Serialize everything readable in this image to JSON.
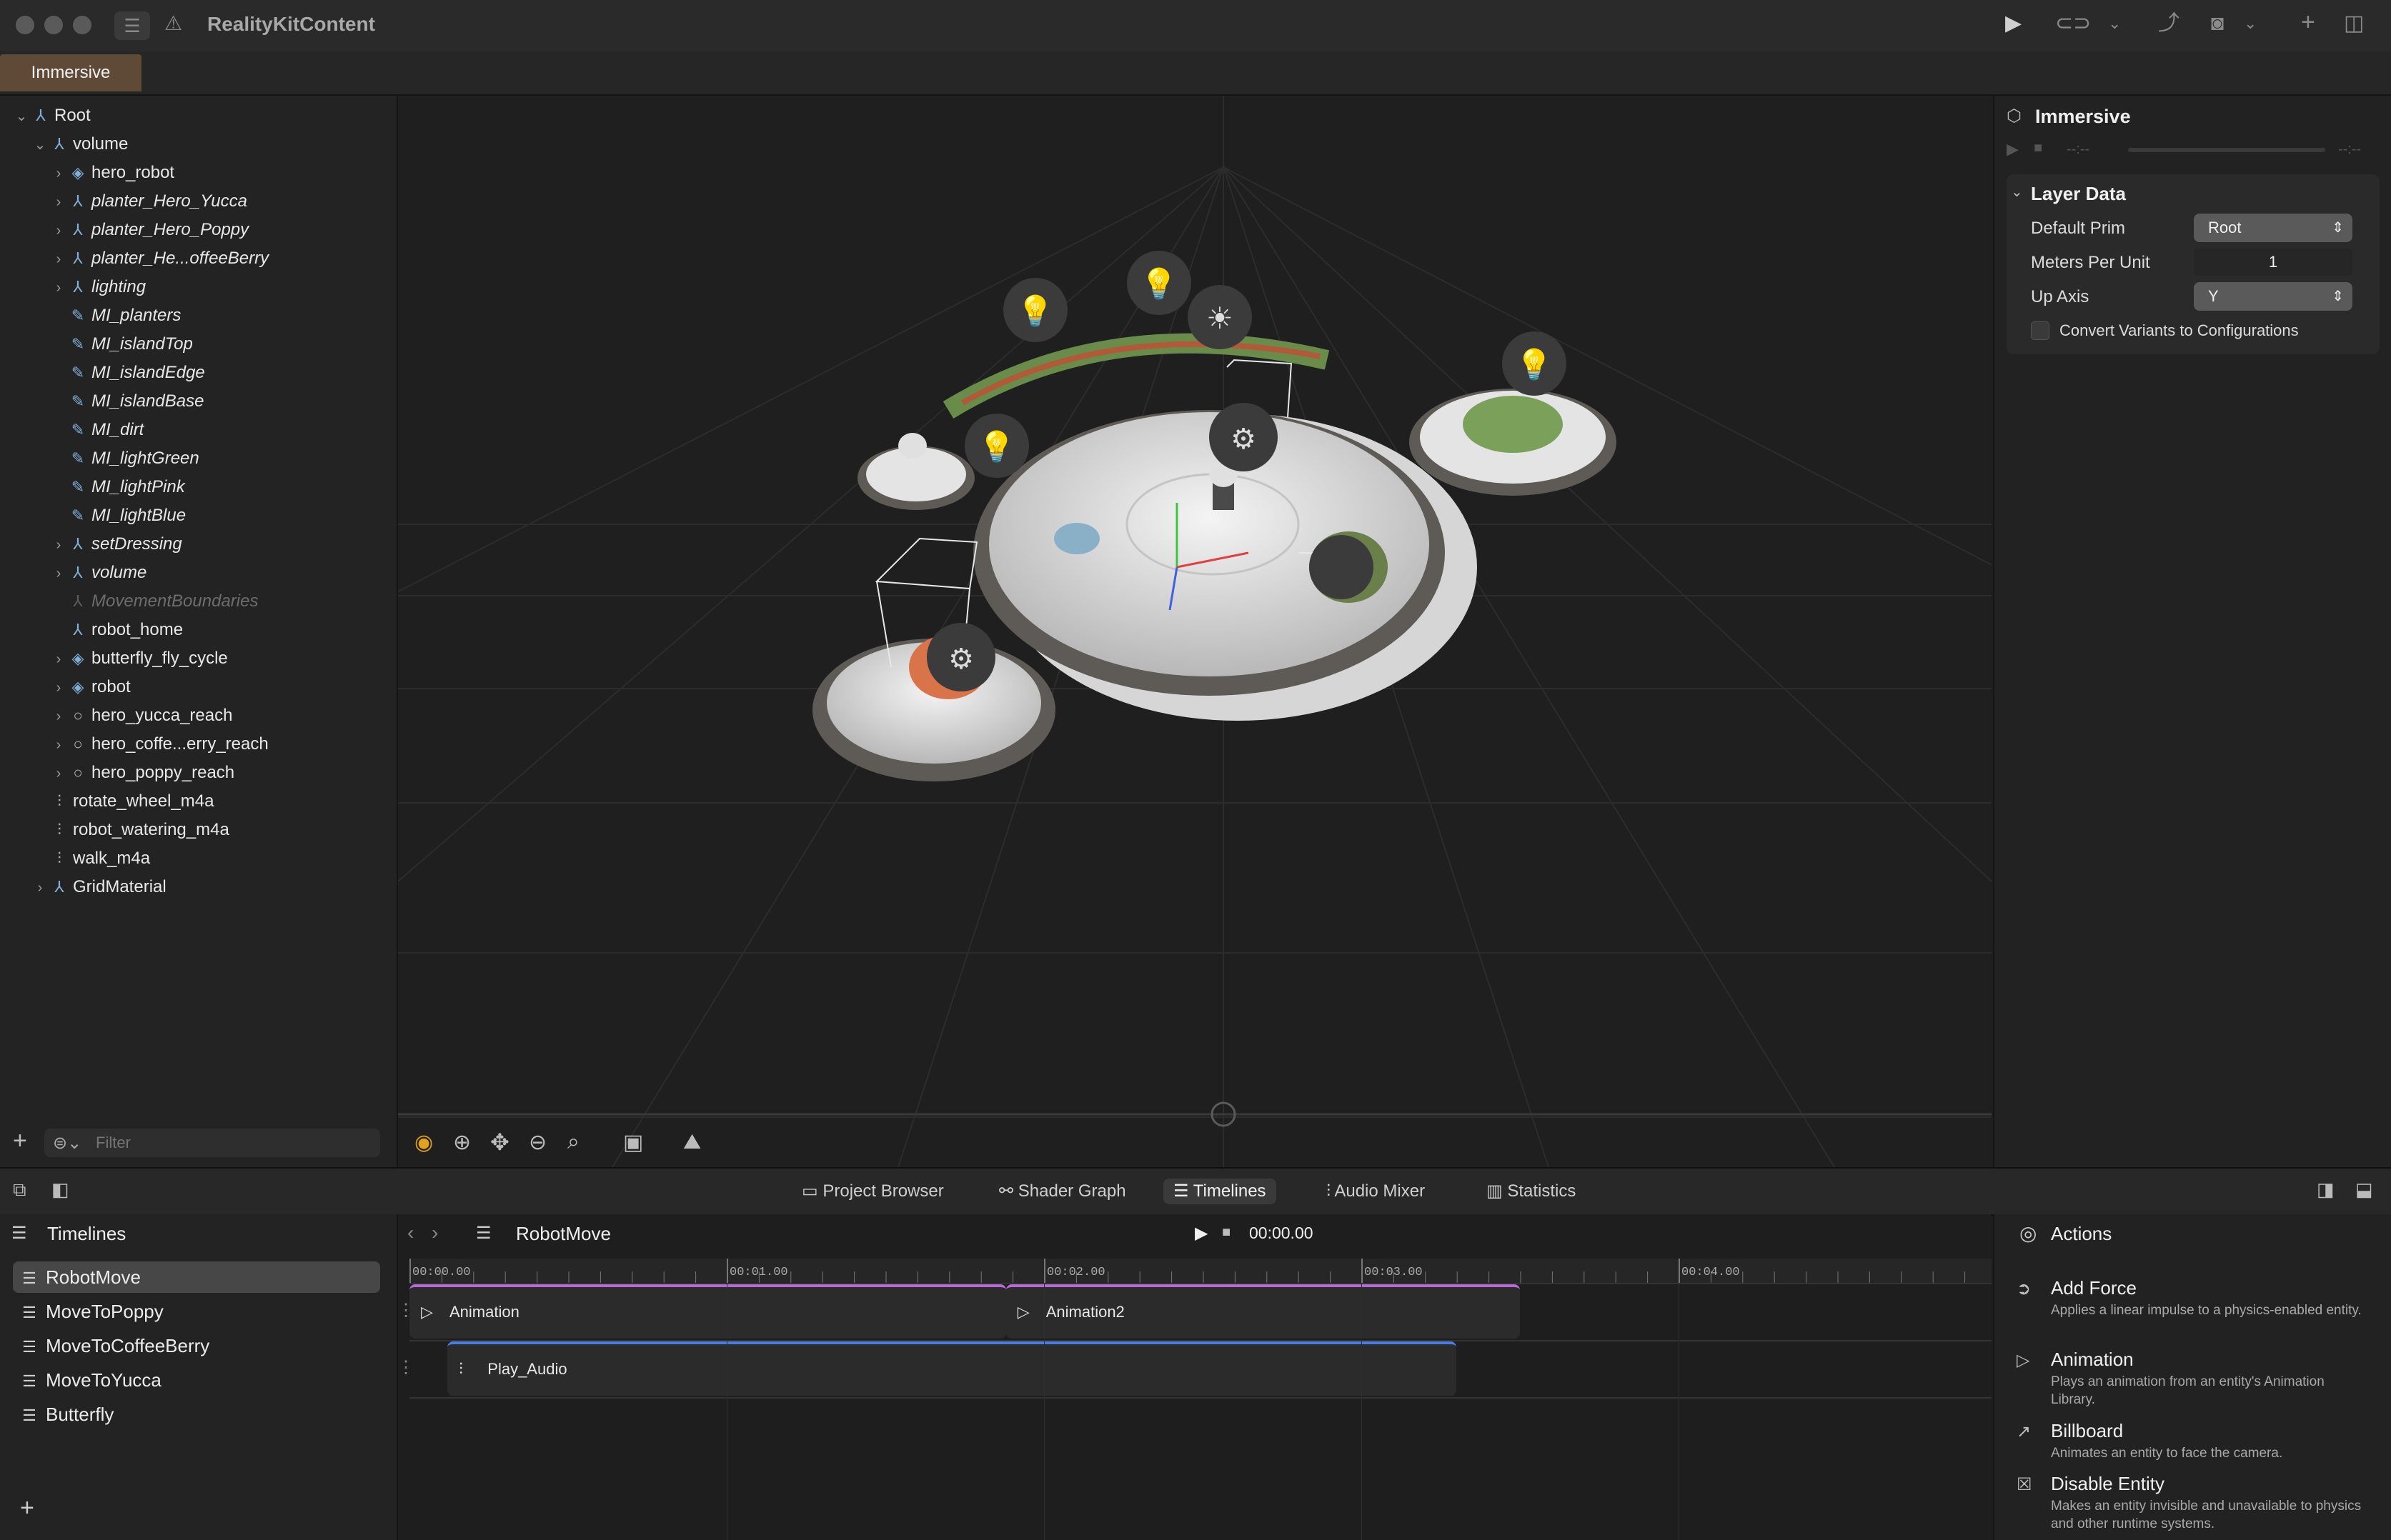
{
  "app": {
    "title": "RealityKitContent"
  },
  "tabs": {
    "immersive": "Immersive"
  },
  "hierarchy": [
    {
      "label": "Root",
      "depth": 0,
      "chevron": "open",
      "icon": "⅄",
      "style": ""
    },
    {
      "label": "volume",
      "depth": 1,
      "chevron": "open",
      "icon": "⅄",
      "style": ""
    },
    {
      "label": "hero_robot",
      "depth": 2,
      "chevron": "closed",
      "icon": "◈",
      "style": ""
    },
    {
      "label": "planter_Hero_Yucca",
      "depth": 2,
      "chevron": "closed",
      "icon": "⅄",
      "style": "italic"
    },
    {
      "label": "planter_Hero_Poppy",
      "depth": 2,
      "chevron": "closed",
      "icon": "⅄",
      "style": "italic"
    },
    {
      "label": "planter_He...offeeBerry",
      "depth": 2,
      "chevron": "closed",
      "icon": "⅄",
      "style": "italic"
    },
    {
      "label": "lighting",
      "depth": 2,
      "chevron": "closed",
      "icon": "⅄",
      "style": "italic"
    },
    {
      "label": "MI_planters",
      "depth": 2,
      "chevron": "",
      "icon": "✎",
      "style": "italic"
    },
    {
      "label": "MI_islandTop",
      "depth": 2,
      "chevron": "",
      "icon": "✎",
      "style": "italic"
    },
    {
      "label": "MI_islandEdge",
      "depth": 2,
      "chevron": "",
      "icon": "✎",
      "style": "italic"
    },
    {
      "label": "MI_islandBase",
      "depth": 2,
      "chevron": "",
      "icon": "✎",
      "style": "italic"
    },
    {
      "label": "MI_dirt",
      "depth": 2,
      "chevron": "",
      "icon": "✎",
      "style": "italic"
    },
    {
      "label": "MI_lightGreen",
      "depth": 2,
      "chevron": "",
      "icon": "✎",
      "style": "italic"
    },
    {
      "label": "MI_lightPink",
      "depth": 2,
      "chevron": "",
      "icon": "✎",
      "style": "italic"
    },
    {
      "label": "MI_lightBlue",
      "depth": 2,
      "chevron": "",
      "icon": "✎",
      "style": "italic"
    },
    {
      "label": "setDressing",
      "depth": 2,
      "chevron": "closed",
      "icon": "⅄",
      "style": "italic"
    },
    {
      "label": "volume",
      "depth": 2,
      "chevron": "closed",
      "icon": "⅄",
      "style": "italic"
    },
    {
      "label": "MovementBoundaries",
      "depth": 2,
      "chevron": "",
      "icon": "⅄",
      "style": "italic dim"
    },
    {
      "label": "robot_home",
      "depth": 2,
      "chevron": "",
      "icon": "⅄",
      "style": ""
    },
    {
      "label": "butterfly_fly_cycle",
      "depth": 2,
      "chevron": "closed",
      "icon": "◈",
      "style": ""
    },
    {
      "label": "robot",
      "depth": 2,
      "chevron": "closed",
      "icon": "◈",
      "style": ""
    },
    {
      "label": "hero_yucca_reach",
      "depth": 2,
      "chevron": "closed",
      "icon": "○",
      "style": "circle"
    },
    {
      "label": "hero_coffe...erry_reach",
      "depth": 2,
      "chevron": "closed",
      "icon": "○",
      "style": "circle"
    },
    {
      "label": "hero_poppy_reach",
      "depth": 2,
      "chevron": "closed",
      "icon": "○",
      "style": "circle"
    },
    {
      "label": "rotate_wheel_m4a",
      "depth": 1,
      "chevron": "",
      "icon": "⫶",
      "style": "audio"
    },
    {
      "label": "robot_watering_m4a",
      "depth": 1,
      "chevron": "",
      "icon": "⫶",
      "style": "audio"
    },
    {
      "label": "walk_m4a",
      "depth": 1,
      "chevron": "",
      "icon": "⫶",
      "style": "audio"
    },
    {
      "label": "GridMaterial",
      "depth": 1,
      "chevron": "closed",
      "icon": "⅄",
      "style": ""
    }
  ],
  "filter": {
    "placeholder": "Filter"
  },
  "inspector": {
    "title": "Immersive",
    "section": "Layer Data",
    "default_prim_label": "Default Prim",
    "default_prim_value": "Root",
    "meters_per_unit_label": "Meters Per Unit",
    "meters_per_unit_value": "1",
    "up_axis_label": "Up Axis",
    "up_axis_value": "Y",
    "convert_variants_label": "Convert Variants to Configurations",
    "convert_variants_checked": false,
    "time_left": "--:--",
    "time_right": "--:--"
  },
  "bottom_tabs": [
    "Project Browser",
    "Shader Graph",
    "Timelines",
    "Audio Mixer",
    "Statistics"
  ],
  "bottom_tabs_active": "Timelines",
  "timelines": {
    "header": "Timelines",
    "items": [
      "RobotMove",
      "MoveToPoppy",
      "MoveToCoffeeBerry",
      "MoveToYucca",
      "Butterfly"
    ],
    "selected": "RobotMove"
  },
  "editor": {
    "name": "RobotMove",
    "time": "00:00.00",
    "ticks": [
      "00:00.00",
      "00:01.00",
      "00:02.00",
      "00:03.00",
      "00:04.00"
    ],
    "clips": [
      {
        "label": "Animation",
        "track": 0,
        "start": 0.0,
        "end": 1.88,
        "color": "#b36bd6",
        "icon": "▷"
      },
      {
        "label": "Animation2",
        "track": 0,
        "start": 1.88,
        "end": 3.5,
        "color": "#b36bd6",
        "icon": "▷"
      },
      {
        "label": "Play_Audio",
        "track": 1,
        "start": 0.12,
        "end": 3.3,
        "color": "#4a7de0",
        "icon": "⫶"
      }
    ]
  },
  "actions": {
    "header": "Actions",
    "items": [
      {
        "title": "Add Force",
        "desc": "Applies a linear impulse to a physics-enabled entity.",
        "icon": "➲"
      },
      {
        "title": "Animation",
        "desc": "Plays an animation from an entity's Animation Library.",
        "icon": "▷"
      },
      {
        "title": "Billboard",
        "desc": "Animates an entity to face the camera.",
        "icon": "↗"
      },
      {
        "title": "Disable Entity",
        "desc": "Makes an entity invisible and unavailable to physics and other runtime systems.",
        "icon": "☒"
      }
    ]
  },
  "colors": {
    "accent": "#5e4a37",
    "clip_purple": "#b36bd6",
    "clip_blue": "#4a7de0"
  }
}
